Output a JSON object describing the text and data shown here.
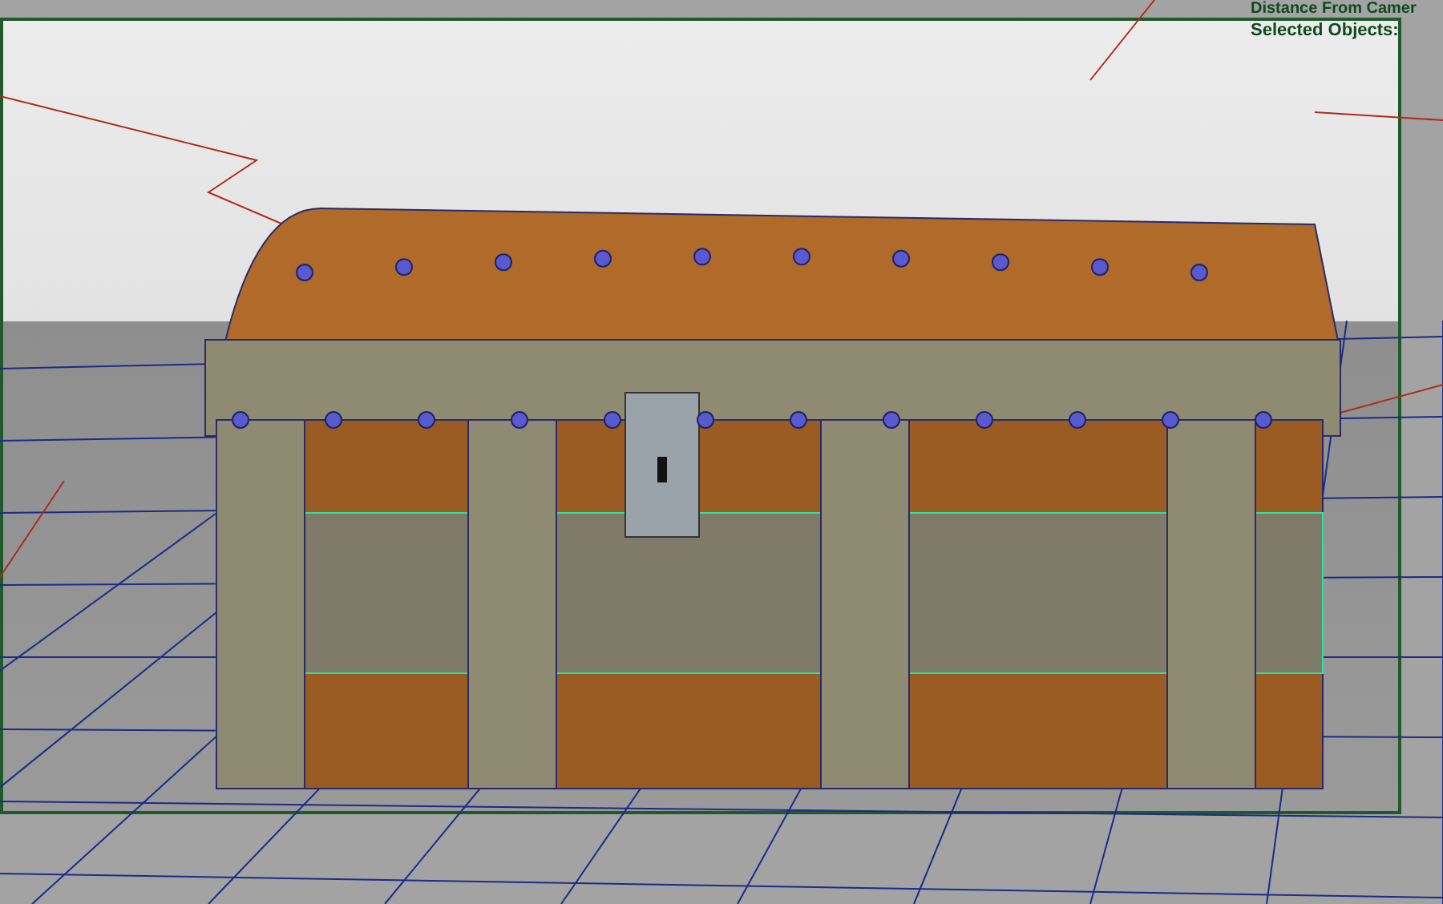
{
  "viewport": {
    "overlay_lines": [
      "Distance From Camer",
      "Selected Objects:"
    ]
  }
}
